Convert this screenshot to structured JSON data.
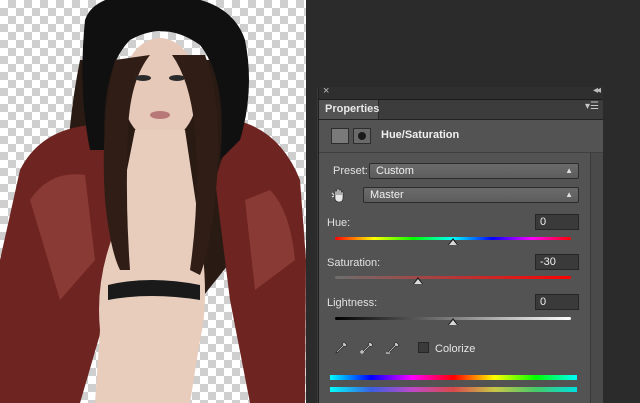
{
  "panel": {
    "tab_label": "Properties",
    "adjustment_title": "Hue/Saturation",
    "menu_icon": "panel-menu-icon",
    "close_icon": "close-icon",
    "collapse_icon": "collapse-arrows-icon"
  },
  "preset": {
    "label": "Preset:",
    "value": "Custom"
  },
  "range": {
    "value": "Master"
  },
  "hue": {
    "label": "Hue:",
    "value": "0",
    "level": 0.5
  },
  "saturation": {
    "label": "Saturation:",
    "value": "-30",
    "level": 0.35
  },
  "lightness": {
    "label": "Lightness:",
    "value": "0",
    "level": 0.5
  },
  "colorize": {
    "label": "Colorize",
    "checked": false
  },
  "icons": {
    "eyedroppers": [
      "eyedropper-icon",
      "eyedropper-plus-icon",
      "eyedropper-minus-icon"
    ],
    "target_adjust": "hand-target-icon"
  },
  "colors": {
    "panel_bg": "#535353",
    "workspace_bg": "#2b2b2b",
    "canvas_checker": "#cfcfcf"
  }
}
